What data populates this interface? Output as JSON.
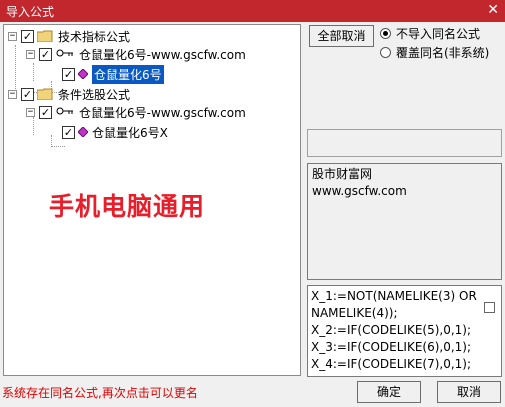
{
  "window": {
    "title": "导入公式",
    "close_glyph": "✕"
  },
  "tree": {
    "nodes": [
      {
        "label": "技术指标公式",
        "expander": "−",
        "checked": true,
        "icon": "folder-icon"
      },
      {
        "label": "仓鼠量化6号-www.gscfw.com",
        "expander": "−",
        "checked": true,
        "icon": "key-icon"
      },
      {
        "label": "仓鼠量化6号",
        "checked": true,
        "icon": "formula-gem-icon",
        "selected": true
      },
      {
        "label": "条件选股公式",
        "expander": "−",
        "checked": true,
        "icon": "folder-icon"
      },
      {
        "label": "仓鼠量化6号-www.gscfw.com",
        "expander": "−",
        "checked": true,
        "icon": "key-icon"
      },
      {
        "label": "仓鼠量化6号X",
        "checked": true,
        "icon": "formula-gem-icon"
      }
    ]
  },
  "overlay_text": "手机电脑通用",
  "right": {
    "cancel_all_label": "全部取消",
    "options": [
      {
        "label": "不导入同名公式",
        "selected": true
      },
      {
        "label": "覆盖同名(非系统)",
        "selected": false
      }
    ],
    "description": [
      "股市财富网",
      "www.gscfw.com"
    ],
    "formula_lines": [
      "X_1:=NOT(NAMELIKE(3) OR",
      "NAMELIKE(4));",
      "X_2:=IF(CODELIKE(5),0,1);",
      "X_3:=IF(CODELIKE(6),0,1);",
      "X_4:=IF(CODELIKE(7),0,1);"
    ]
  },
  "footer": {
    "status_text": "系统存在同名公式,再次点击可以更名",
    "ok_label": "确定",
    "cancel_label": "取消"
  }
}
